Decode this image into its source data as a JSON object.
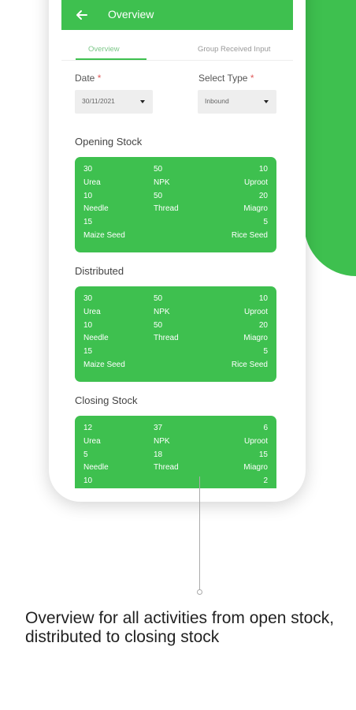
{
  "appbar": {
    "title": "Overview",
    "back_icon": "arrow-left-icon"
  },
  "tabs": [
    {
      "label": "Overview",
      "active": true
    },
    {
      "label": "Group Received Input",
      "active": false
    }
  ],
  "date_field": {
    "label": "Date",
    "required_mark": "*",
    "value": "30/11/2021"
  },
  "type_field": {
    "label": "Select Type",
    "required_mark": "*",
    "value": "Inbound"
  },
  "sections": {
    "opening": {
      "title": "Opening Stock",
      "rows": [
        [
          "30",
          "50",
          "10"
        ],
        [
          "Urea",
          "NPK",
          "Uproot"
        ],
        [
          "10",
          "50",
          "20"
        ],
        [
          "Needle",
          "Thread",
          "Miagro"
        ],
        [
          "15",
          "",
          "5"
        ],
        [
          "Maize Seed",
          "",
          "Rice Seed"
        ]
      ]
    },
    "distributed": {
      "title": "Distributed",
      "rows": [
        [
          "30",
          "50",
          "10"
        ],
        [
          "Urea",
          "NPK",
          "Uproot"
        ],
        [
          "10",
          "50",
          "20"
        ],
        [
          "Needle",
          "Thread",
          "Miagro"
        ],
        [
          "15",
          "",
          "5"
        ],
        [
          "Maize Seed",
          "",
          "Rice Seed"
        ]
      ]
    },
    "closing": {
      "title": "Closing Stock",
      "rows": [
        [
          "12",
          "37",
          "6"
        ],
        [
          "Urea",
          "NPK",
          "Uproot"
        ],
        [
          "5",
          "18",
          "15"
        ],
        [
          "Needle",
          "Thread",
          "Miagro"
        ],
        [
          "10",
          "",
          "2"
        ]
      ]
    }
  },
  "caption": "Overview for all activities from open stock, distributed to closing stock",
  "colors": {
    "accent": "#3ec04f",
    "required": "#e05a5a"
  }
}
